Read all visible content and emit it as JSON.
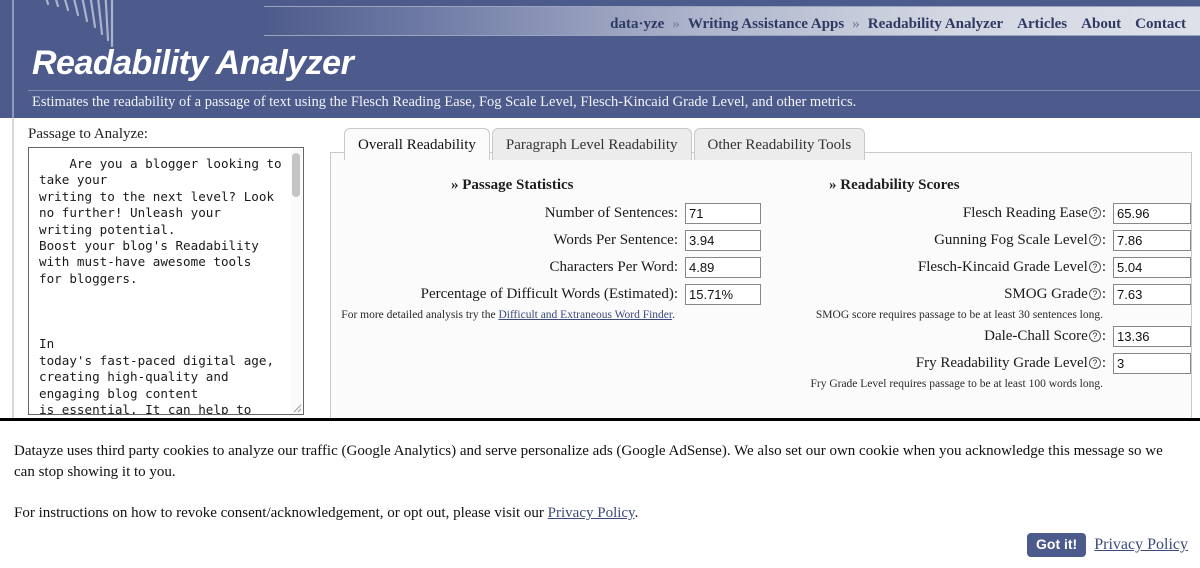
{
  "header": {
    "site_title": "Readability Analyzer",
    "tagline": "Estimates the readability of a passage of text using the Flesch Reading Ease, Fog Scale Level, Flesch-Kincaid Grade Level, and other metrics.",
    "nav": {
      "brand": "data·yze",
      "sep1": "»",
      "crumb1": "Writing Assistance Apps",
      "sep2": "»",
      "crumb2": "Readability Analyzer",
      "link_articles": "Articles",
      "link_about": "About",
      "link_contact": "Contact"
    }
  },
  "passage": {
    "label": "Passage to Analyze:",
    "text": "    Are you a blogger looking to take your\nwriting to the next level? Look no further! Unleash your\nwriting potential.\nBoost your blog's Readability with must-have awesome tools\nfor bloggers.\n\n\n\nIn\ntoday's fast-paced digital age,\ncreating high-quality and\nengaging blog content\nis essential. It can help to"
  },
  "tabs": [
    {
      "label": "Overall Readability",
      "active": true
    },
    {
      "label": "Paragraph Level Readability",
      "active": false
    },
    {
      "label": "Other Readability Tools",
      "active": false
    }
  ],
  "passage_statistics": {
    "heading": "» Passage Statistics",
    "rows": [
      {
        "label": "Number of Sentences:",
        "value": "71"
      },
      {
        "label": "Words Per Sentence:",
        "value": "3.94"
      },
      {
        "label": "Characters Per Word:",
        "value": "4.89"
      },
      {
        "label": "Percentage of Difficult Words (Estimated):",
        "value": "15.71%"
      }
    ],
    "note_prefix": "For more detailed analysis try the ",
    "note_link": "Difficult and Extraneous Word Finder",
    "note_suffix": "."
  },
  "readability_scores": {
    "heading": "» Readability Scores",
    "rows": [
      {
        "label": "Flesch Reading Ease",
        "value": "65.96",
        "help": "?"
      },
      {
        "label": "Gunning Fog Scale Level",
        "value": "7.86",
        "help": "?"
      },
      {
        "label": "Flesch-Kincaid Grade Level",
        "value": "5.04",
        "help": "?"
      },
      {
        "label": "SMOG Grade",
        "value": "7.63",
        "help": "?"
      },
      {
        "label": "Dale-Chall Score",
        "value": "13.36",
        "help": "?"
      },
      {
        "label": "Fry Readability Grade Level",
        "value": "3",
        "help": "?"
      }
    ],
    "smog_note": "SMOG score requires passage to be at least 30 sentences long.",
    "fry_note": "Fry Grade Level requires passage to be at least 100 words long."
  },
  "cookie_banner": {
    "paragraph1": "Datayze uses third party cookies to analyze our traffic (Google Analytics) and serve personalize ads (Google AdSense). We also set our own cookie when you acknowledge this message so we can stop showing it to you.",
    "paragraph2_prefix": "For instructions on how to revoke consent/acknowledgement, or opt out, please visit our ",
    "paragraph2_link": "Privacy Policy",
    "paragraph2_suffix": ".",
    "accept_label": "Got it!",
    "privacy_label": "Privacy Policy"
  },
  "colors": {
    "header_blue": "#4d5b8c",
    "link_blue": "#3b4a7a",
    "panel_bg": "#fbfbfb"
  }
}
